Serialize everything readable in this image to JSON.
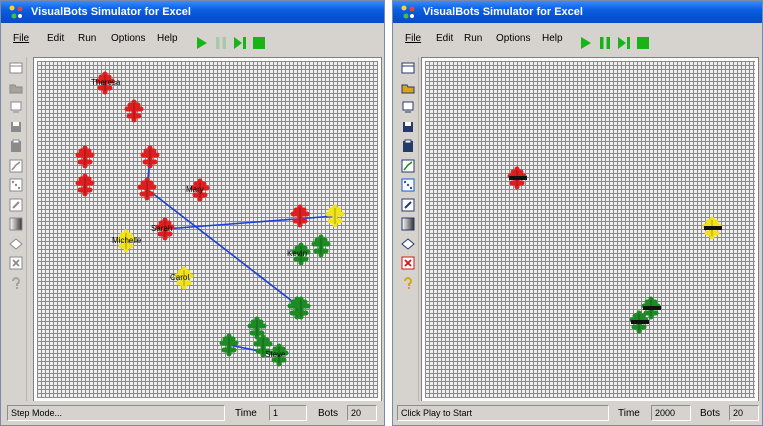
{
  "windows": [
    {
      "title": "VisualBots Simulator for Excel",
      "menu": [
        "File",
        "Edit",
        "Run",
        "Options",
        "Help"
      ],
      "controls": [
        "play-icon",
        "pause-icon",
        "step-icon",
        "stop-icon"
      ],
      "tools": [
        "grid-icon",
        "open-folder-icon",
        "export-icon",
        "save-icon",
        "clipboard-icon",
        "chart-icon",
        "dice-icon",
        "edit-icon",
        "gradient-icon",
        "diamond-icon",
        "close-icon",
        "help-icon"
      ],
      "tools_enabled": false,
      "status": {
        "message": "Step Mode...",
        "time_label": "Time",
        "time_value": "1",
        "bots_label": "Bots",
        "bots_value": "20"
      },
      "bots": [
        {
          "name": "Theresa",
          "color": "#dd1f1f"
        },
        {
          "name": "",
          "color": "#dd1f1f"
        },
        {
          "name": "",
          "color": "#dd1f1f"
        },
        {
          "name": "",
          "color": "#dd1f1f"
        },
        {
          "name": "",
          "color": "#dd1f1f"
        },
        {
          "name": "",
          "color": "#dd1f1f"
        },
        {
          "name": "Sarah",
          "color": "#dd1f1f"
        },
        {
          "name": "Mary",
          "color": "#dd1f1f"
        },
        {
          "name": "",
          "color": "#dd1f1f"
        },
        {
          "name": "Michelle",
          "color": "#f1e21a"
        },
        {
          "name": "Carol",
          "color": "#f1e21a"
        },
        {
          "name": "",
          "color": "#f1e21a"
        },
        {
          "name": "",
          "color": "#1d8a23"
        },
        {
          "name": "Kevin",
          "color": "#1d8a23"
        },
        {
          "name": "",
          "color": "#1d8a23"
        },
        {
          "name": "",
          "color": "#1d8a23"
        },
        {
          "name": "",
          "color": "#1d8a23"
        },
        {
          "name": "",
          "color": "#1d8a23"
        },
        {
          "name": "Steve",
          "color": "#1d8a23"
        },
        {
          "name": "",
          "color": "#1d8a23"
        }
      ]
    },
    {
      "title": "VisualBots Simulator for Excel",
      "menu": [
        "File",
        "Edit",
        "Run",
        "Options",
        "Help"
      ],
      "controls": [
        "play-icon",
        "pause-icon",
        "step-icon",
        "stop-icon"
      ],
      "tools": [
        "grid-icon",
        "open-folder-icon",
        "export-icon",
        "save-icon",
        "clipboard-icon",
        "chart-icon",
        "dice-icon",
        "edit-icon",
        "gradient-icon",
        "diamond-icon",
        "close-icon",
        "help-icon"
      ],
      "tools_enabled": true,
      "status": {
        "message": "Click Play to Start",
        "time_label": "Time",
        "time_value": "2000",
        "bots_label": "Bots",
        "bots_value": "20"
      },
      "bots": [
        {
          "name": "",
          "color": "#dd1f1f"
        },
        {
          "name": "",
          "color": "#f1e21a"
        },
        {
          "name": "",
          "color": "#1d8a23"
        },
        {
          "name": "",
          "color": "#1d8a23"
        }
      ]
    }
  ]
}
